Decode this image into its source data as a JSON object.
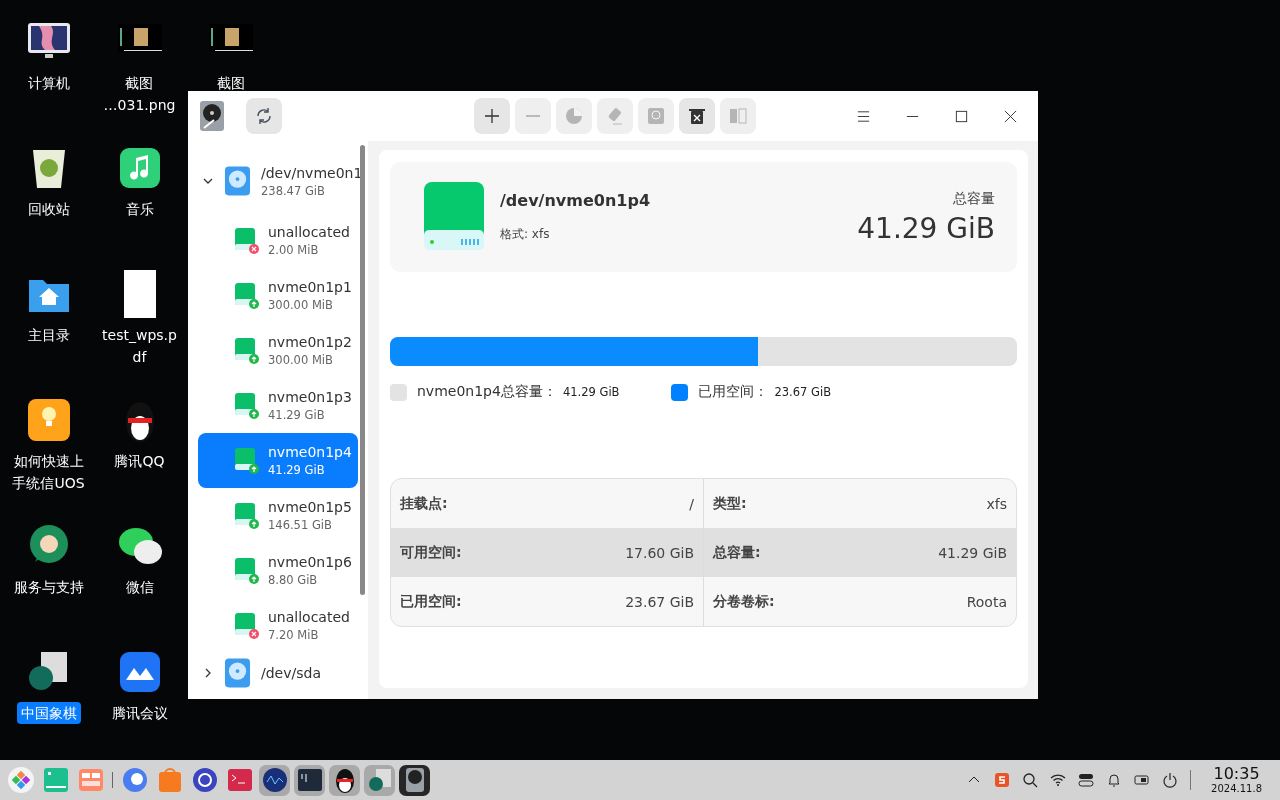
{
  "desktop_icons": [
    {
      "kind": "computer",
      "lines": [
        "计算机"
      ],
      "selected": false
    },
    {
      "kind": "trash",
      "lines": [
        "回收站"
      ],
      "selected": false
    },
    {
      "kind": "home-folder",
      "lines": [
        "主目录"
      ],
      "selected": false
    },
    {
      "kind": "bulb",
      "lines": [
        "如何快速上",
        "手统信UOS"
      ],
      "selected": false
    },
    {
      "kind": "headset",
      "lines": [
        "服务与支持"
      ],
      "selected": false
    },
    {
      "kind": "chess",
      "lines": [
        "中国象棋"
      ],
      "selected": true
    },
    {
      "kind": "screenshot",
      "lines": [
        "截图",
        "…031.png"
      ],
      "selected": false
    },
    {
      "kind": "music",
      "lines": [
        "音乐"
      ],
      "selected": false
    },
    {
      "kind": "document",
      "lines": [
        "test_wps.p",
        "df"
      ],
      "selected": false
    },
    {
      "kind": "penguin",
      "lines": [
        "腾讯QQ"
      ],
      "selected": false
    },
    {
      "kind": "chat",
      "lines": [
        "微信"
      ],
      "selected": false
    },
    {
      "kind": "meeting",
      "lines": [
        "腾讯会议"
      ],
      "selected": false
    },
    {
      "kind": "screenshot",
      "lines": [
        "截图"
      ],
      "selected": false
    }
  ],
  "toolbar": {
    "actions": [
      {
        "kind": "add",
        "disabled": false
      },
      {
        "kind": "remove",
        "disabled": true
      },
      {
        "kind": "partition",
        "disabled": true
      },
      {
        "kind": "wipe",
        "disabled": true
      },
      {
        "kind": "restore",
        "disabled": true
      },
      {
        "kind": "delete",
        "disabled": false
      },
      {
        "kind": "split",
        "disabled": true
      }
    ]
  },
  "sidebar": {
    "disks": [
      {
        "name": "/dev/nvme0n1",
        "size": "238.47 GiB",
        "expanded": true,
        "children": [
          {
            "name": "unallocated",
            "size": "2.00 MiB",
            "kind": "unallocated",
            "selected": false
          },
          {
            "name": "nvme0n1p1",
            "size": "300.00 MiB",
            "kind": "partition",
            "selected": false
          },
          {
            "name": "nvme0n1p2",
            "size": "300.00 MiB",
            "kind": "partition",
            "selected": false
          },
          {
            "name": "nvme0n1p3",
            "size": "41.29 GiB",
            "kind": "partition",
            "selected": false
          },
          {
            "name": "nvme0n1p4",
            "size": "41.29 GiB",
            "kind": "partition",
            "selected": true
          },
          {
            "name": "nvme0n1p5",
            "size": "146.51 GiB",
            "kind": "partition",
            "selected": false
          },
          {
            "name": "nvme0n1p6",
            "size": "8.80 GiB",
            "kind": "partition",
            "selected": false
          },
          {
            "name": "unallocated",
            "size": "7.20 MiB",
            "kind": "unallocated",
            "selected": false
          }
        ]
      },
      {
        "name": "/dev/sda",
        "expanded": false
      }
    ]
  },
  "detail": {
    "name": "/dev/nvme0n1p4",
    "format": "格式: xfs",
    "total_label": "总容量",
    "total_value": "41.29 GiB",
    "usage": {
      "level": 0.587
    },
    "legend": [
      {
        "label": "nvme0n1p4总容量：",
        "value": "41.29 GiB",
        "color": "#e3e3e3"
      },
      {
        "label": "已用空间：",
        "value": "23.67 GiB",
        "color": "#0081ff"
      }
    ],
    "info": [
      [
        {
          "label": "挂载点:",
          "value": "/"
        },
        {
          "label": "类型:",
          "value": "xfs"
        }
      ],
      [
        {
          "label": "可用空间:",
          "value": "17.60 GiB"
        },
        {
          "label": "总容量:",
          "value": "41.29 GiB"
        }
      ],
      [
        {
          "label": "已用空间:",
          "value": "23.67 GiB"
        },
        {
          "label": "分卷卷标:",
          "value": "Roota"
        }
      ]
    ]
  },
  "taskbar": {
    "apps": [
      {
        "kind": "launcher",
        "running": false,
        "selected": false
      },
      {
        "kind": "multitask",
        "running": false,
        "selected": false
      },
      {
        "kind": "workspace",
        "running": false,
        "selected": false
      },
      {
        "kind": "browser",
        "running": false,
        "selected": false
      },
      {
        "kind": "store",
        "running": false,
        "selected": false
      },
      {
        "kind": "settings",
        "running": false,
        "selected": false
      },
      {
        "kind": "terminal-red",
        "running": false,
        "selected": false
      },
      {
        "kind": "monitor",
        "running": true,
        "selected": false
      },
      {
        "kind": "terminal",
        "running": true,
        "selected": false
      },
      {
        "kind": "penguin",
        "running": true,
        "selected": false
      },
      {
        "kind": "chess",
        "running": true,
        "selected": false
      },
      {
        "kind": "disk",
        "running": true,
        "selected": true
      }
    ],
    "time": "10:35",
    "date": "2024.11.8"
  }
}
